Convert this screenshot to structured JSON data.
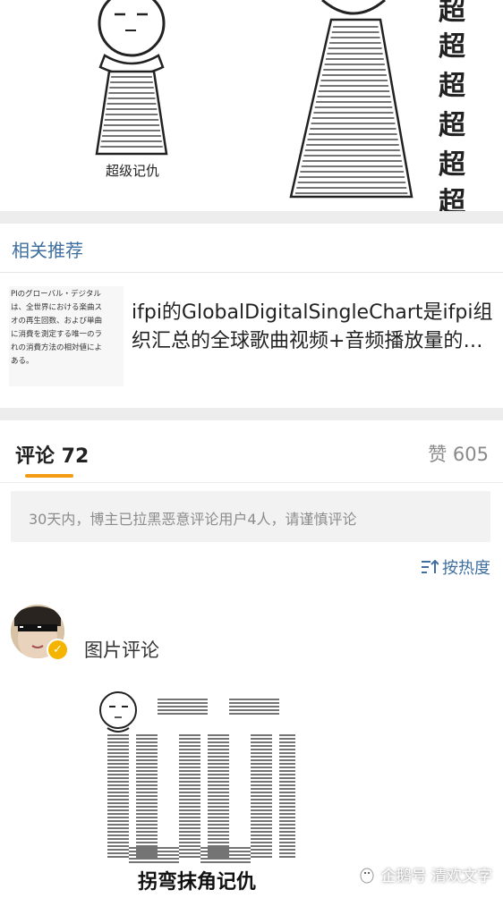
{
  "meme_top": {
    "caption": "超级记仇",
    "chars": [
      "超",
      "超",
      "超",
      "超",
      "超",
      "超"
    ]
  },
  "related": {
    "title": "相关推荐",
    "thumbnail_lines": [
      "PIのグローバル・デジタル",
      "は、全世界における楽曲ス",
      "オの再生回数、および単曲",
      "に消費を測定する唯一のラ",
      "れの消費方法の相対値によ",
      "ある。"
    ],
    "article_title": "ifpi的GlobalDigitalSingleChart是ifpi组织汇总的全球歌曲视频+音频播放量的榜单"
  },
  "comments": {
    "tab_label": "评论 72",
    "likes_label": "赞 605",
    "notice": "30天内，博主已拉黑恶意评论用户4人，请谨慎评论",
    "sort_label": "按热度",
    "items": [
      {
        "text": "图片评论",
        "image_caption": "拐弯抹角记仇"
      }
    ]
  },
  "watermark": {
    "text": "企鹅号 清欢文字"
  },
  "colors": {
    "accent": "#f39c12",
    "link": "#3f6f9e",
    "separator": "#ededed",
    "badge": "#f5b400"
  }
}
